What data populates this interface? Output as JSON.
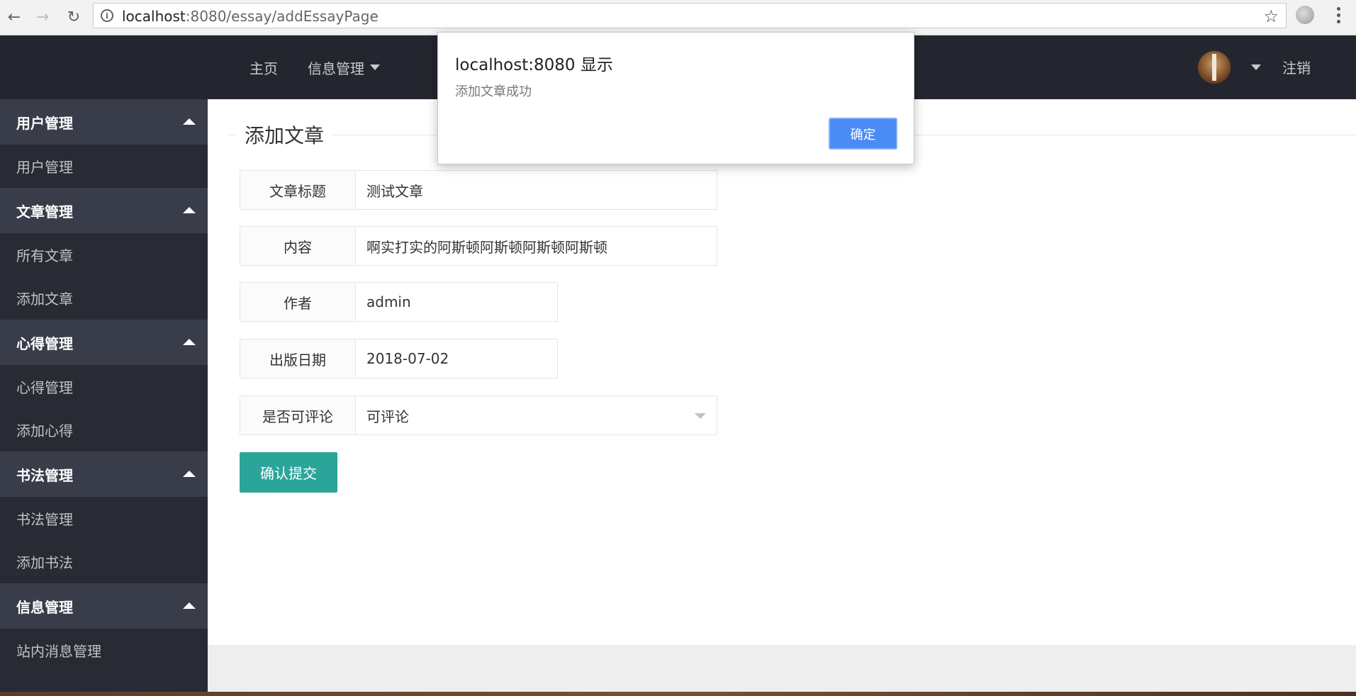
{
  "browser": {
    "url_host": "localhost",
    "url_path": ":8080/essay/addEssayPage"
  },
  "header": {
    "nav": [
      {
        "label": "主页"
      },
      {
        "label": "信息管理"
      }
    ],
    "logout": "注销"
  },
  "sidebar": {
    "groups": [
      {
        "label": "用户管理",
        "items": [
          "用户管理"
        ]
      },
      {
        "label": "文章管理",
        "items": [
          "所有文章",
          "添加文章"
        ]
      },
      {
        "label": "心得管理",
        "items": [
          "心得管理",
          "添加心得"
        ]
      },
      {
        "label": "书法管理",
        "items": [
          "书法管理",
          "添加书法"
        ]
      },
      {
        "label": "信息管理",
        "items": [
          "站内消息管理"
        ]
      }
    ]
  },
  "form": {
    "title": "添加文章",
    "fields": [
      {
        "label": "文章标题",
        "value": "测试文章"
      },
      {
        "label": "内容",
        "value": "啊实打实的阿斯顿阿斯顿阿斯顿阿斯顿"
      },
      {
        "label": "作者",
        "value": "admin"
      },
      {
        "label": "出版日期",
        "value": "2018-07-02"
      },
      {
        "label": "是否可评论",
        "value": "可评论"
      }
    ],
    "submit": "确认提交"
  },
  "dialog": {
    "title": "localhost:8080 显示",
    "message": "添加文章成功",
    "ok": "确定"
  },
  "colors": {
    "header_bg": "#23262e",
    "sidebar_bg": "#282b33",
    "sidebar_group_bg": "#393d49",
    "submit_bg": "#2ba59a",
    "dialog_ok_bg": "#4b8bf4"
  }
}
